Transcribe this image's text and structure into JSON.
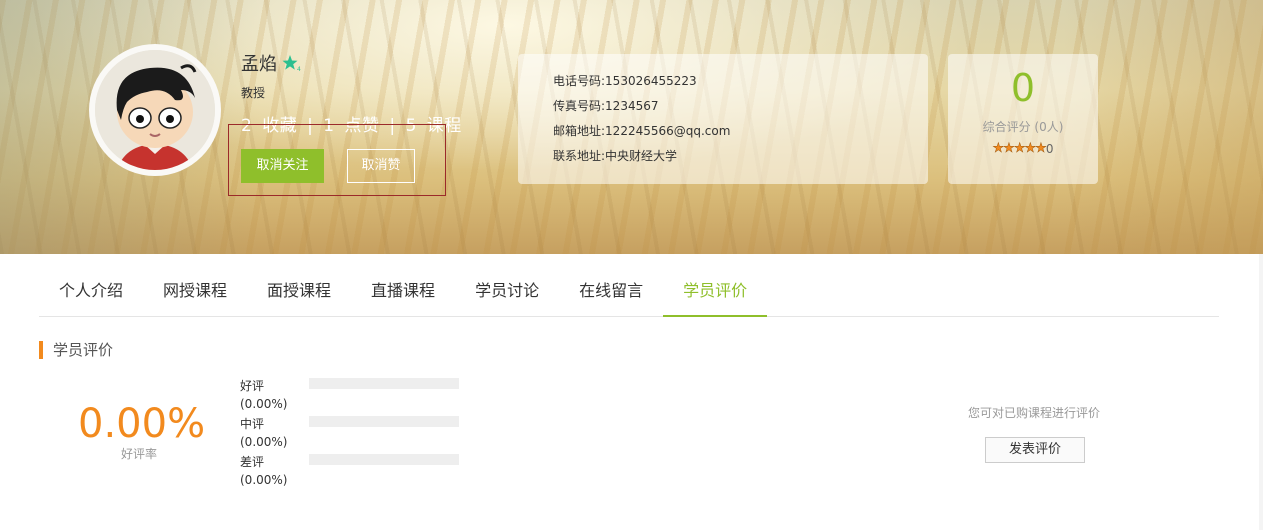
{
  "profile": {
    "name": "孟焰",
    "rank": "教授",
    "favorites_count": "2",
    "favorites_label": "收藏",
    "likes_count": "1",
    "likes_label": "点赞",
    "courses_count": "5",
    "courses_label": "课程",
    "separator": "|",
    "unfollow_label": "取消关注",
    "unlike_label": "取消赞",
    "badge_icon": "star-badge-icon"
  },
  "contact": {
    "phone": "电话号码:153026455223",
    "fax": "传真号码:1234567",
    "email": "邮箱地址:122245566@qq.com",
    "address": "联系地址:中央财经大学"
  },
  "rating": {
    "score": "0",
    "label": "综合评分 (0人)",
    "stars": "★★★★★",
    "stars_value": 0,
    "stars_count": "0"
  },
  "tabs": [
    {
      "label": "个人介绍"
    },
    {
      "label": "网授课程"
    },
    {
      "label": "面授课程"
    },
    {
      "label": "直播课程"
    },
    {
      "label": "学员讨论"
    },
    {
      "label": "在线留言"
    },
    {
      "label": "学员评价",
      "active": true
    }
  ],
  "reviews": {
    "section_title": "学员评价",
    "positive_rate": "0.00%",
    "positive_rate_label": "好评率",
    "bars": [
      {
        "label": "好评",
        "percent_text": "(0.00%)",
        "fraction": 0
      },
      {
        "label": "中评",
        "percent_text": "(0.00%)",
        "fraction": 0
      },
      {
        "label": "差评",
        "percent_text": "(0.00%)",
        "fraction": 0
      }
    ],
    "hint": "您可对已购课程进行评价",
    "post_review_label": "发表评价"
  },
  "colors": {
    "accent_green": "#8fbf2b",
    "accent_orange": "#f28a1e"
  }
}
